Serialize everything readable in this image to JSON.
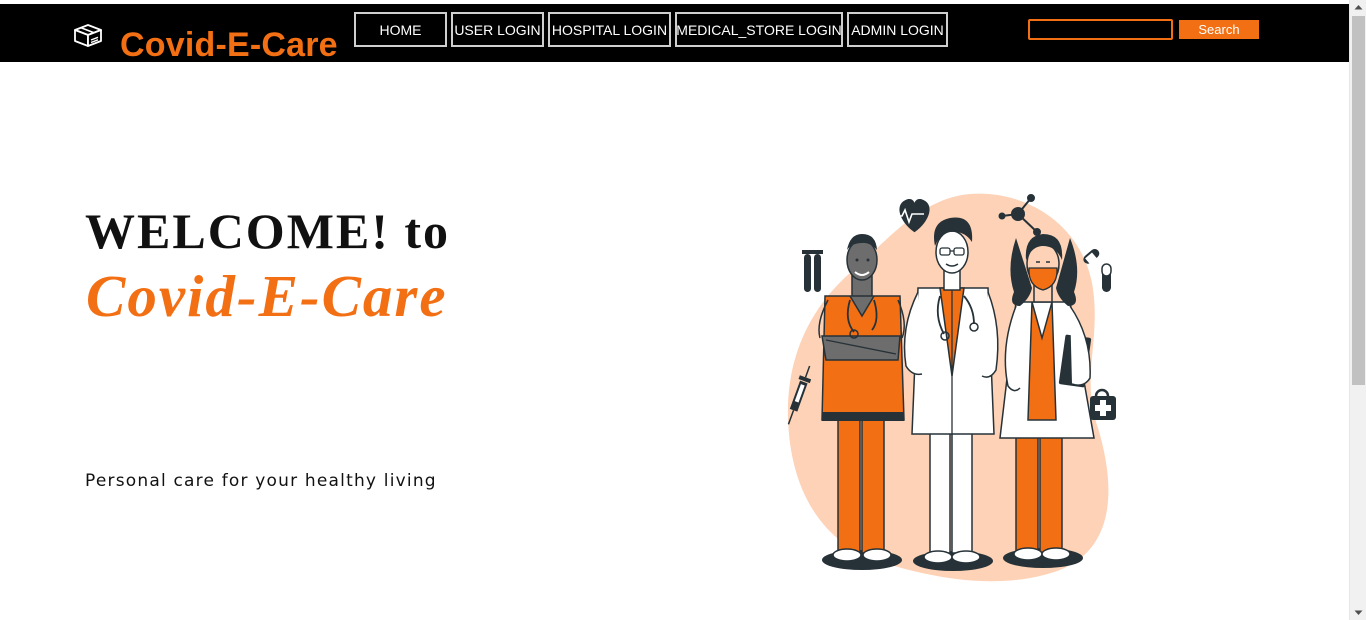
{
  "header": {
    "logo_icon": "box-icon",
    "brand": "Covid-E-Care",
    "nav": [
      {
        "label": "HOME"
      },
      {
        "label": "USER LOGIN"
      },
      {
        "label": "HOSPITAL LOGIN"
      },
      {
        "label": "MEDICAL_STORE LOGIN"
      },
      {
        "label": "ADMIN LOGIN"
      }
    ],
    "search": {
      "value": "",
      "placeholder": "",
      "button_label": "Search"
    }
  },
  "hero": {
    "welcome": "WELCOME! to",
    "brand": "Covid-E-Care",
    "tagline": "Personal care for your healthy living",
    "illustration": "medical-staff-illustration"
  },
  "colors": {
    "accent": "#f36f13",
    "navbar": "#000000",
    "blob": "#fdd2b6",
    "ink": "#263238"
  }
}
